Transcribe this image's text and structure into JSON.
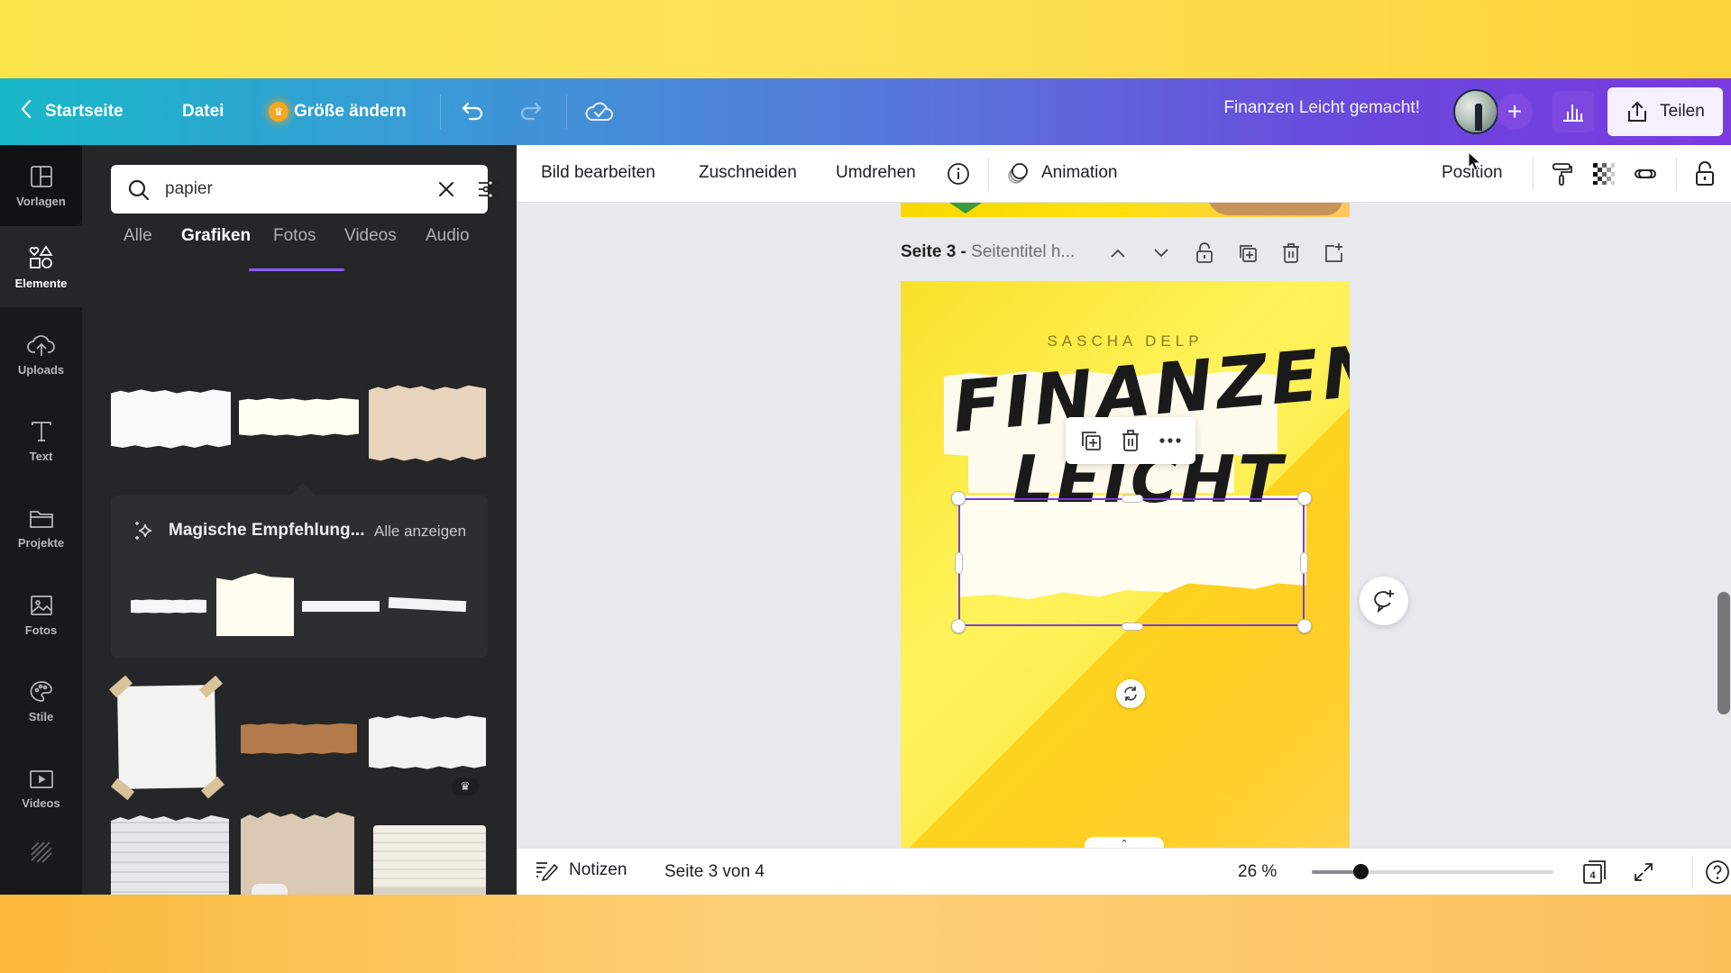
{
  "topbar": {
    "back_label": "Startseite",
    "file_label": "Datei",
    "resize_label": "Größe ändern",
    "design_title": "Finanzen Leicht gemacht!",
    "add_label": "+",
    "share_label": "Teilen",
    "icons": [
      "chevron-left-icon",
      "crown-icon",
      "undo-icon",
      "redo-icon",
      "cloud-saved-icon",
      "avatar",
      "plus-icon",
      "insights-icon",
      "share-icon"
    ]
  },
  "rail": {
    "items": [
      {
        "label": "Vorlagen",
        "icon": "templates-icon"
      },
      {
        "label": "Elemente",
        "icon": "elements-icon",
        "active": true
      },
      {
        "label": "Uploads",
        "icon": "upload-cloud-icon"
      },
      {
        "label": "Text",
        "icon": "text-icon"
      },
      {
        "label": "Projekte",
        "icon": "folder-icon"
      },
      {
        "label": "Fotos",
        "icon": "image-icon"
      },
      {
        "label": "Stile",
        "icon": "palette-icon"
      },
      {
        "label": "Videos",
        "icon": "video-icon"
      }
    ]
  },
  "panel": {
    "search": {
      "value": "papier",
      "placeholder": ""
    },
    "tabs": [
      {
        "label": "Alle"
      },
      {
        "label": "Grafiken",
        "active": true
      },
      {
        "label": "Fotos"
      },
      {
        "label": "Videos"
      },
      {
        "label": "Audio"
      }
    ],
    "magic": {
      "title": "Magische Empfehlung...",
      "see_all": "Alle anzeigen"
    },
    "premium_badge": "♛"
  },
  "context_toolbar": {
    "edit_image": "Bild bearbeiten",
    "crop": "Zuschneiden",
    "flip": "Umdrehen",
    "animation": "Animation",
    "position": "Position"
  },
  "canvas": {
    "page_label": "Seite 3 - ",
    "page_subtitle": "Seitentitel h...",
    "design": {
      "author": "SASCHA DELP",
      "title_line1": "FINANZEN",
      "title_line2": "LEICHT"
    },
    "colors": {
      "selection": "#7d3ce0",
      "page_yellow": "#f8e12a"
    }
  },
  "bottombar": {
    "notes_label": "Notizen",
    "page_indicator": "Seite 3 von 4",
    "zoom_label": "26 %",
    "zoom_percent": 26,
    "page_count": "4"
  },
  "colors": {
    "topbar_start": "#18b8c8",
    "topbar_end": "#7a3ae0",
    "accent": "#8b5cf6",
    "panel_bg": "#252627",
    "rail_bg": "#18191b"
  }
}
